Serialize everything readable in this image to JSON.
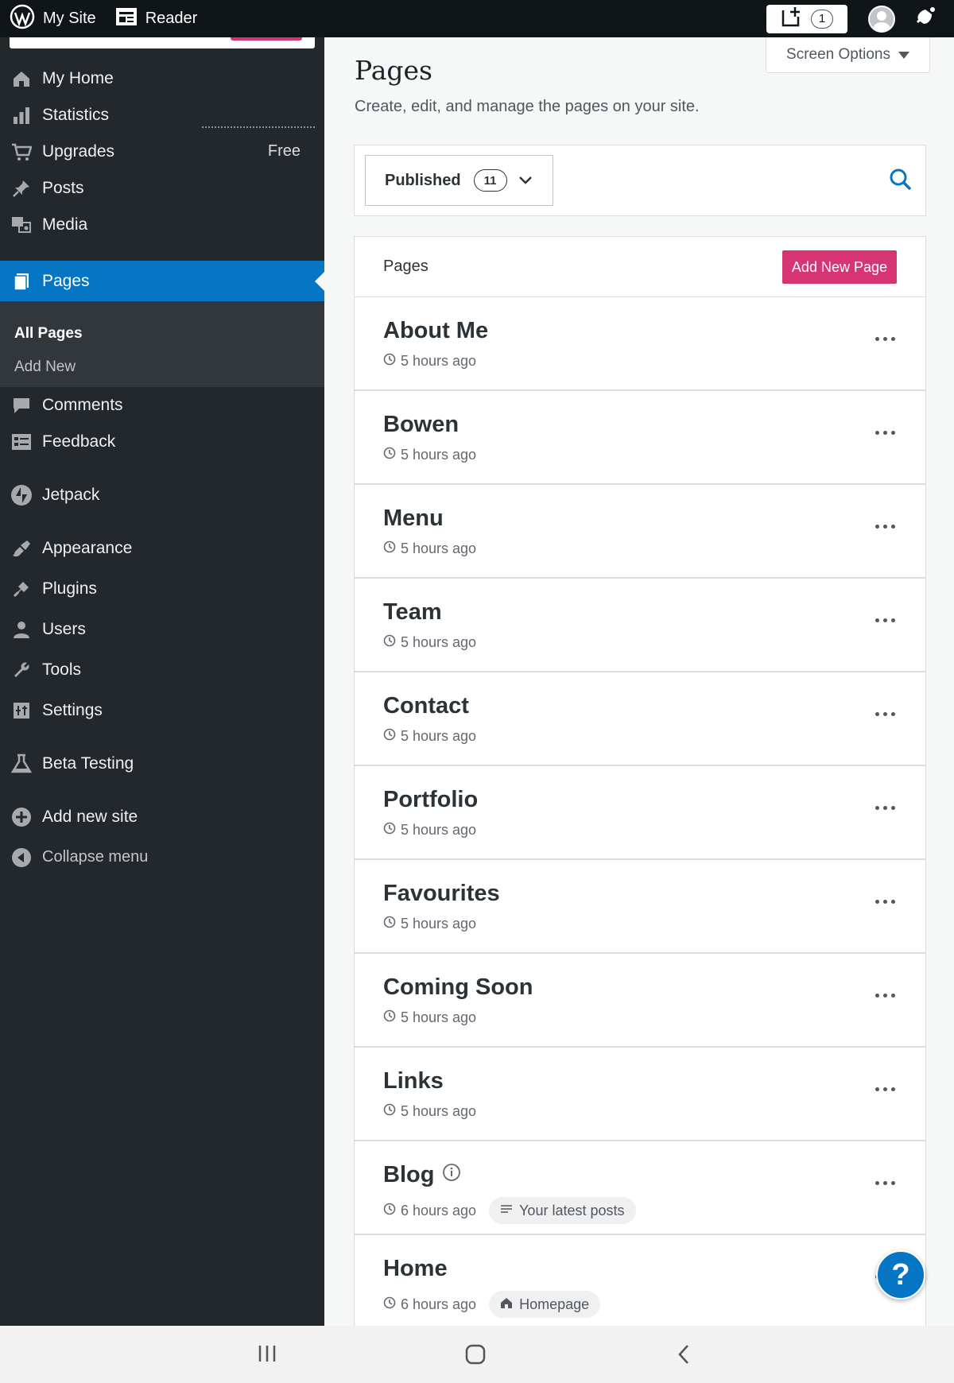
{
  "topbar": {
    "my_site": "My Site",
    "reader": "Reader",
    "write_count": "1"
  },
  "sidebar": {
    "items": [
      {
        "key": "my-home",
        "label": "My Home",
        "icon": "home-icon"
      },
      {
        "key": "statistics",
        "label": "Statistics",
        "icon": "bar-chart-icon"
      },
      {
        "key": "upgrades",
        "label": "Upgrades",
        "badge": "Free",
        "icon": "cart-icon"
      },
      {
        "key": "posts",
        "label": "Posts",
        "icon": "pushpin-icon"
      },
      {
        "key": "media",
        "label": "Media",
        "icon": "media-icon"
      },
      {
        "key": "pages",
        "label": "Pages",
        "icon": "pages-icon",
        "active": true
      },
      {
        "key": "comments",
        "label": "Comments",
        "icon": "comment-icon"
      },
      {
        "key": "feedback",
        "label": "Feedback",
        "icon": "feedback-icon"
      },
      {
        "key": "jetpack",
        "label": "Jetpack",
        "icon": "jetpack-icon"
      },
      {
        "key": "appearance",
        "label": "Appearance",
        "icon": "brush-icon"
      },
      {
        "key": "plugins",
        "label": "Plugins",
        "icon": "plug-icon"
      },
      {
        "key": "users",
        "label": "Users",
        "icon": "user-icon"
      },
      {
        "key": "tools",
        "label": "Tools",
        "icon": "wrench-icon"
      },
      {
        "key": "settings",
        "label": "Settings",
        "icon": "settings-icon"
      },
      {
        "key": "beta-testing",
        "label": "Beta Testing",
        "icon": "flask-icon"
      },
      {
        "key": "add-new-site",
        "label": "Add new site",
        "icon": "plus-circle-icon"
      },
      {
        "key": "collapse-menu",
        "label": "Collapse menu",
        "icon": "collapse-icon"
      }
    ],
    "submenu": {
      "all_pages": "All Pages",
      "add_new": "Add New"
    }
  },
  "main": {
    "screen_options": "Screen Options",
    "title": "Pages",
    "subtitle": "Create, edit, and manage the pages on your site.",
    "filter": {
      "status": "Published",
      "count": "11"
    },
    "list_header": "Pages",
    "add_new_button": "Add New Page",
    "pages": [
      {
        "title": "About Me",
        "time": "5 hours ago"
      },
      {
        "title": "Bowen",
        "time": "5 hours ago"
      },
      {
        "title": "Menu",
        "time": "5 hours ago"
      },
      {
        "title": "Team",
        "time": "5 hours ago"
      },
      {
        "title": "Contact",
        "time": "5 hours ago"
      },
      {
        "title": "Portfolio",
        "time": "5 hours ago"
      },
      {
        "title": "Favourites",
        "time": "5 hours ago"
      },
      {
        "title": "Coming Soon",
        "time": "5 hours ago"
      },
      {
        "title": "Links",
        "time": "5 hours ago"
      },
      {
        "title": "Blog",
        "time": "6 hours ago",
        "badge": "Your latest posts"
      },
      {
        "title": "Home",
        "time": "6 hours ago",
        "badge": "Homepage"
      }
    ]
  },
  "help_label": "?",
  "colors": {
    "admin_bar": "#101517",
    "sidebar": "#23282d",
    "accent_blue": "#0675c4",
    "accent_pink": "#d63472"
  }
}
